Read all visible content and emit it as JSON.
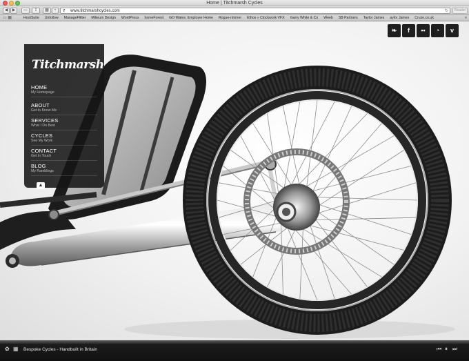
{
  "browser": {
    "window_title": "Home | Titchmarsh Cycles",
    "url": "www.titchmarshcycles.com",
    "reader_label": "Reader",
    "bookmarks": [
      "HootSuite",
      "Unfollow",
      "ManageFlitter",
      "Milieum Design",
      "WordPress",
      "homeForest",
      "GO Wales: Employer Home",
      "Rogue-rimmer",
      "Ethos » Clockwork VFX",
      "Garry White & Co",
      "Weeb",
      "SB Partners",
      "Taylor James",
      "aylor James",
      "Cruze.co.uk"
    ]
  },
  "site": {
    "logo_text": "Titchmarsh",
    "nav": [
      {
        "title": "HOME",
        "sub": "My Homepage"
      },
      {
        "title": "ABOUT",
        "sub": "Get to Know Me"
      },
      {
        "title": "SERVICES",
        "sub": "What I Do Best"
      },
      {
        "title": "CYCLES",
        "sub": "See My Work"
      },
      {
        "title": "CONTACT",
        "sub": "Get In Touch"
      },
      {
        "title": "BLOG",
        "sub": "My Ramblings"
      }
    ],
    "social": [
      {
        "name": "twitter-icon",
        "glyph": "❧"
      },
      {
        "name": "facebook-icon",
        "glyph": "f"
      },
      {
        "name": "flickr-icon",
        "glyph": "••"
      },
      {
        "name": "rss-icon",
        "glyph": "◔"
      },
      {
        "name": "vimeo-icon",
        "glyph": "v"
      }
    ],
    "footer_caption": "Bespoke Cycles - Handbuilt in Britain"
  }
}
